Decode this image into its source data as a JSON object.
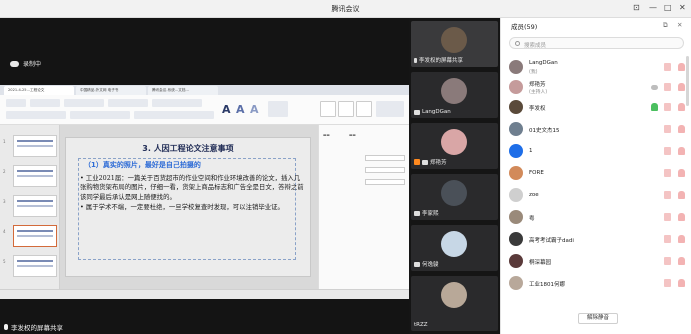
{
  "window": {
    "title": "腾讯会议"
  },
  "share": {
    "recording_label": "录制中",
    "share_label": "李发权的屏幕共享",
    "ppt": {
      "tabs": [
        "2021-4-25...工程论文",
        "中国精品-外文网 电子书",
        "腾讯会议-系统...文档..."
      ],
      "ribbon_big_letters": [
        "A",
        "A",
        "A"
      ],
      "slide": {
        "title": "3. 人因工程论文注意事项",
        "subtitle": "（1）真实的照片，最好是自己拍摄的",
        "paragraphs": [
          "• 工业2021届：一篇关于百货超市的作业空间和作业环境改善的论文，插入几张购物货架布局的图片，仔细一看，货架上商品标志和广告全是日文，答辩之前该同学最后承认是网上随便找的。",
          "• 属于学术不端，一定要杜绝，一旦学校复查时发现，可以注销毕业证。"
        ]
      },
      "thumb_numbers": [
        "1",
        "2",
        "3",
        "4",
        "5"
      ]
    }
  },
  "tiles": [
    {
      "name": "李发权的屏幕共享",
      "color": "#6b5a49",
      "active": true
    },
    {
      "name": "LangDGan",
      "color": "#8a7a7a"
    },
    {
      "name": "郑艳芳",
      "color": "#d9a6a6",
      "host": true
    },
    {
      "name": "李家熙",
      "color": "#4a5058"
    },
    {
      "name": "何逸骏",
      "color": "#c7d7e6"
    },
    {
      "name": "tRZZ",
      "color": "#b8a898"
    }
  ],
  "members": {
    "title": "成员(59)",
    "search_placeholder": "搜索成员",
    "unmute_all": "解除静音",
    "list": [
      {
        "name": "LangDGan",
        "sub": "(我)",
        "color": "#8a7a7a"
      },
      {
        "name": "郑艳芳",
        "sub": "(主持人)",
        "color": "#c59b9b"
      },
      {
        "name": "李发权",
        "color": "#5a4a3a"
      },
      {
        "name": "01史文杰15",
        "color": "#6f7f8f"
      },
      {
        "name": "1",
        "color": "#1e6ee8"
      },
      {
        "name": "FORE",
        "color": "#d28a5a"
      },
      {
        "name": "zoe",
        "color": "#cfcfcf"
      },
      {
        "name": "粤",
        "color": "#9a8a7a"
      },
      {
        "name": "高考考试霸子dadi",
        "color": "#3a3a3a"
      },
      {
        "name": "桐深幕园",
        "color": "#5a3a3a"
      },
      {
        "name": "工业1801何娜",
        "color": "#b8a89a"
      }
    ]
  }
}
